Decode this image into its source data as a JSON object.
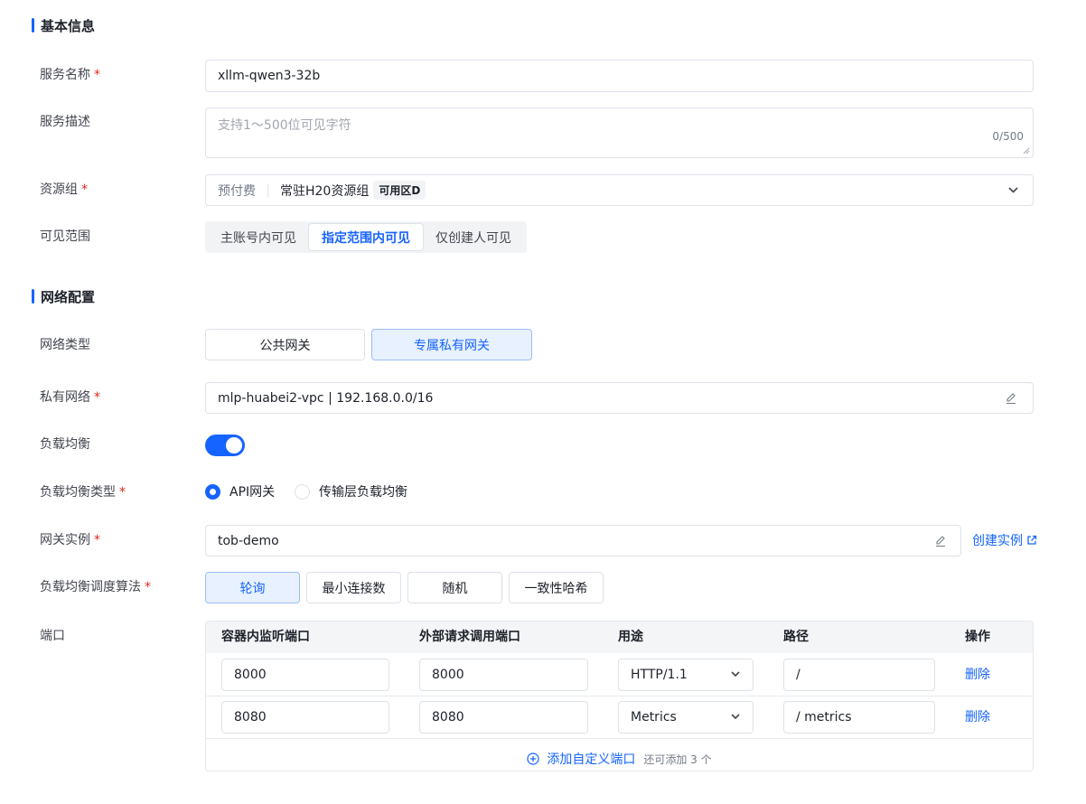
{
  "sections": {
    "basic": "基本信息",
    "network": "网络配置"
  },
  "fields": {
    "service_name": {
      "label": "服务名称",
      "value": "xllm-qwen3-32b"
    },
    "service_desc": {
      "label": "服务描述",
      "placeholder": "支持1～500位可见字符",
      "counter": "0/500"
    },
    "resource_group": {
      "label": "资源组",
      "billing": "预付费",
      "value": "常驻H20资源组",
      "zone_tag": "可用区D"
    },
    "visibility": {
      "label": "可见范围",
      "options": [
        "主账号内可见",
        "指定范围内可见",
        "仅创建人可见"
      ],
      "selected": "指定范围内可见"
    },
    "network_type": {
      "label": "网络类型",
      "options": [
        "公共网关",
        "专属私有网关"
      ],
      "selected": "专属私有网关"
    },
    "vpc": {
      "label": "私有网络",
      "value": "mlp-huabei2-vpc | 192.168.0.0/16"
    },
    "load_balance": {
      "label": "负载均衡",
      "enabled": true
    },
    "lb_type": {
      "label": "负载均衡类型",
      "options": [
        "API网关",
        "传输层负载均衡"
      ],
      "selected": "API网关"
    },
    "gateway": {
      "label": "网关实例",
      "value": "tob-demo",
      "create_link": "创建实例"
    },
    "lb_algo": {
      "label": "负载均衡调度算法",
      "options": [
        "轮询",
        "最小连接数",
        "随机",
        "一致性哈希"
      ],
      "selected": "轮询"
    },
    "ports": {
      "label": "端口",
      "columns": [
        "容器内监听端口",
        "外部请求调用端口",
        "用途",
        "路径",
        "操作"
      ],
      "rows": [
        {
          "container_port": "8000",
          "external_port": "8000",
          "usage": "HTTP/1.1",
          "path": "/",
          "action": "删除"
        },
        {
          "container_port": "8080",
          "external_port": "8080",
          "usage": "Metrics",
          "path": "/ metrics",
          "action": "删除"
        }
      ],
      "add_label": "添加自定义端口",
      "add_hint": "还可添加 3 个"
    }
  },
  "colors": {
    "accent": "#1664ff",
    "required": "#e0281c"
  }
}
